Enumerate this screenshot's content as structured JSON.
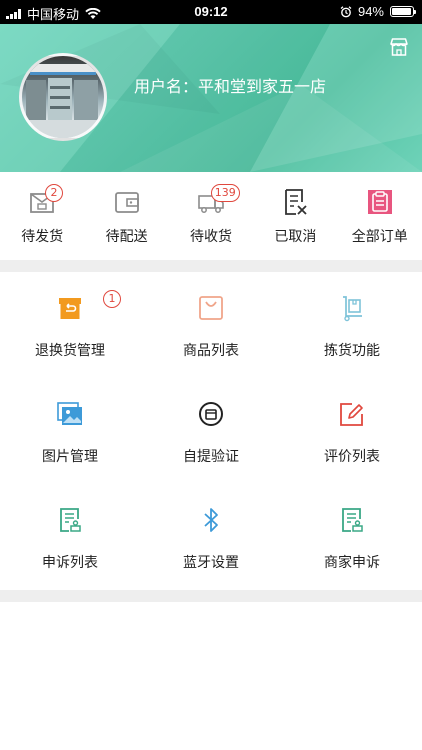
{
  "status_bar": {
    "carrier": "中国移动",
    "time": "09:12",
    "battery": "94%",
    "battery_level": 0.94
  },
  "header": {
    "username": "用户名：平和堂到家五一店",
    "store_icon": "store-icon"
  },
  "orders": [
    {
      "label": "待发货",
      "icon": "package-icon",
      "badge": "2",
      "color": "#8c8c8c"
    },
    {
      "label": "待配送",
      "icon": "wallet-icon",
      "badge": "",
      "color": "#8c8c8c"
    },
    {
      "label": "待收货",
      "icon": "truck-icon",
      "badge": "139",
      "color": "#8c8c8c"
    },
    {
      "label": "已取消",
      "icon": "cancelled-list-icon",
      "badge": "",
      "color": "#333333"
    },
    {
      "label": "全部订单",
      "icon": "clipboard-icon",
      "badge": "",
      "color": "#e8557f"
    }
  ],
  "grid": [
    {
      "label": "退换货管理",
      "icon": "return-box-icon",
      "badge": "1",
      "color": "#f29a1f"
    },
    {
      "label": "商品列表",
      "icon": "shopping-bag-icon",
      "badge": "",
      "color": "#f0a58a"
    },
    {
      "label": "拣货功能",
      "icon": "hand-truck-icon",
      "badge": "",
      "color": "#7ec3d9"
    },
    {
      "label": "图片管理",
      "icon": "image-gallery-icon",
      "badge": "",
      "color": "#3d9ad8"
    },
    {
      "label": "自提验证",
      "icon": "verify-circle-icon",
      "badge": "",
      "color": "#222222"
    },
    {
      "label": "评价列表",
      "icon": "edit-review-icon",
      "badge": "",
      "color": "#e0483e"
    },
    {
      "label": "申诉列表",
      "icon": "complaint-doc-icon",
      "badge": "",
      "color": "#3aa886"
    },
    {
      "label": "蓝牙设置",
      "icon": "bluetooth-icon",
      "badge": "",
      "color": "#3d9ad8"
    },
    {
      "label": "商家申诉",
      "icon": "merchant-complaint-icon",
      "badge": "",
      "color": "#3aa886"
    }
  ]
}
